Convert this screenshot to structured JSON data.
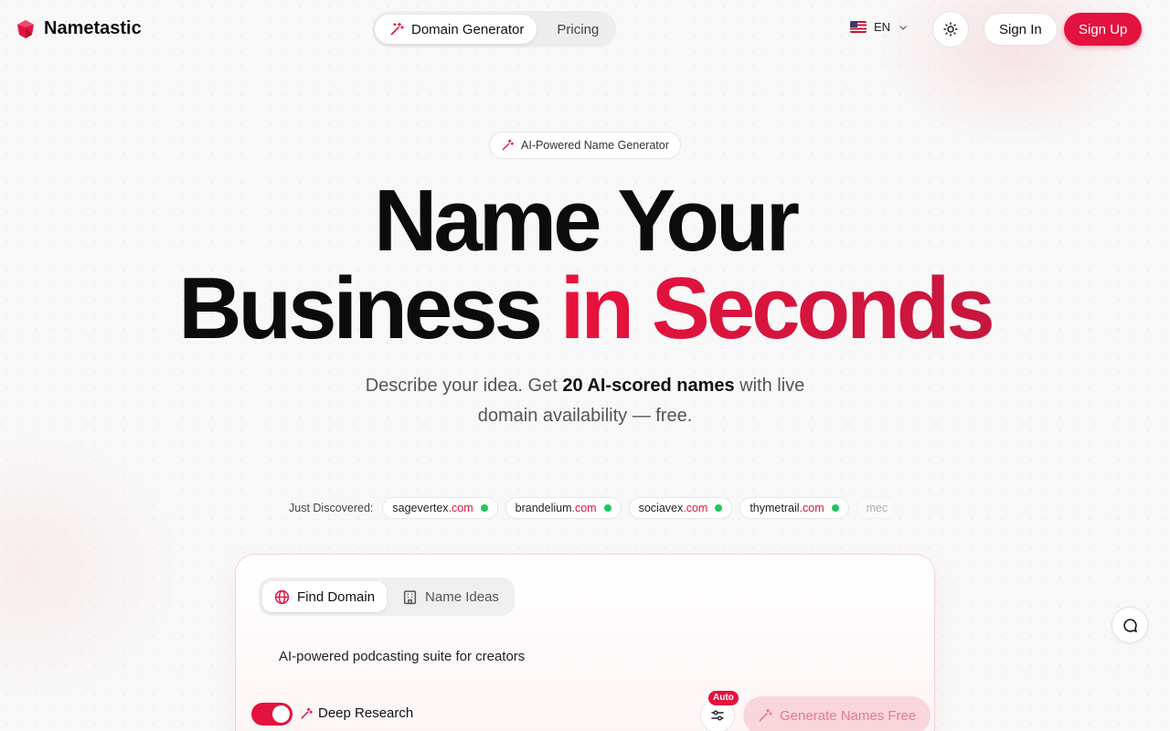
{
  "brand": {
    "name": "Nametastic",
    "accent": "#e3123e"
  },
  "nav": {
    "items": [
      {
        "label": "Domain Generator",
        "icon": "magic-wand-icon",
        "active": true
      },
      {
        "label": "Pricing",
        "active": false
      }
    ]
  },
  "header": {
    "language": "EN",
    "language_flag": "us-flag-icon",
    "theme_icon": "sun-icon",
    "sign_in": "Sign In",
    "sign_up": "Sign Up"
  },
  "hero": {
    "badge": "AI-Powered Name Generator",
    "title_line1": "Name Your",
    "title_line2_plain": "Business",
    "title_line2_accent": "in Seconds",
    "subtitle_pre": "Describe your idea. Get",
    "subtitle_bold": "20 AI-scored names",
    "subtitle_post": "with live domain availability — free."
  },
  "discovered": {
    "label": "Just Discovered:",
    "items": [
      {
        "name": "sagevertex",
        "tld": ".com",
        "available": true
      },
      {
        "name": "brandelium",
        "tld": ".com",
        "available": true
      },
      {
        "name": "sociavex",
        "tld": ".com",
        "available": true
      },
      {
        "name": "thymetrail",
        "tld": ".com",
        "available": true
      },
      {
        "name": "mec",
        "tld": "",
        "available": false
      }
    ]
  },
  "generator": {
    "tabs": [
      {
        "label": "Find Domain",
        "icon": "globe-icon",
        "active": true
      },
      {
        "label": "Name Ideas",
        "icon": "building-icon",
        "active": false
      }
    ],
    "prompt_value": "AI-powered podcasting suite for creators",
    "deep_research_label": "Deep Research",
    "deep_research_on": true,
    "auto_badge": "Auto",
    "generate_label": "Generate Names Free"
  }
}
